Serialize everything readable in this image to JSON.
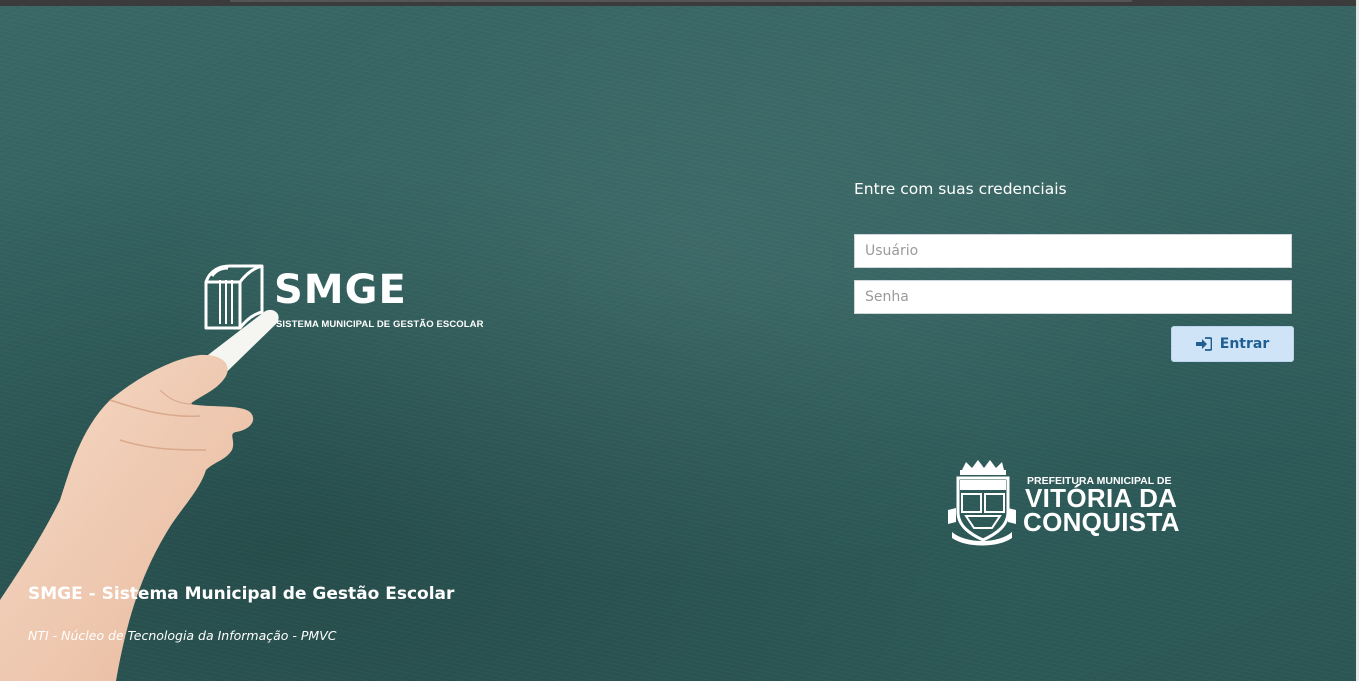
{
  "brand": {
    "logo_text": "SMGE",
    "logo_subtext": "SISTEMA MUNICIPAL DE GESTÃO ESCOLAR"
  },
  "login": {
    "heading": "Entre com suas credenciais",
    "username_placeholder": "Usuário",
    "password_placeholder": "Senha",
    "submit_label": "Entrar",
    "submit_icon": "sign-in-icon"
  },
  "prefeitura": {
    "line1": "PREFEITURA MUNICIPAL DE",
    "line2": "VITÓRIA DA",
    "line3": "CONQUISTA",
    "crest_text": "VITÓRIA DA CONQUISTA"
  },
  "footer": {
    "title": "SMGE - Sistema Municipal de Gestão Escolar",
    "subtitle": "NTI - Núcleo de Tecnologia da Informação - PMVC"
  },
  "colors": {
    "background": "#2f5f5d",
    "button_bg": "#cfe5f7",
    "button_text": "#1f5f93"
  }
}
